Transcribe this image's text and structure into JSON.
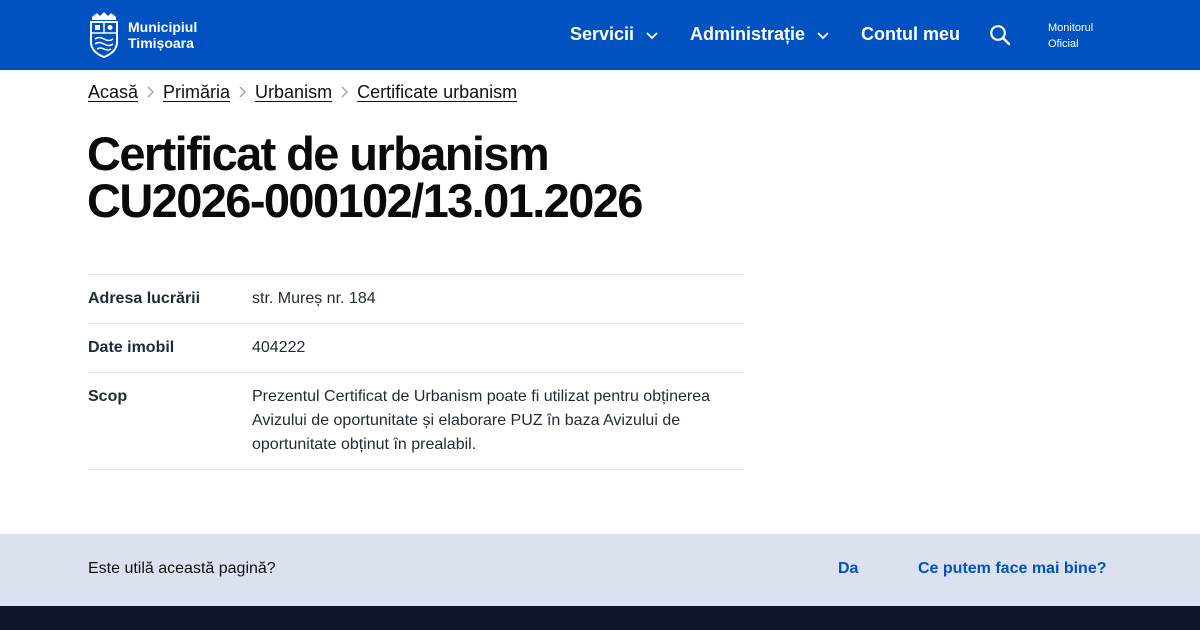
{
  "colors": {
    "brand": "#0052c1",
    "feedback_bg": "#dbe1ee",
    "footer_bg": "#0f1628"
  },
  "header": {
    "logo": {
      "icon": "city-crest-icon",
      "line1": "Municipiul",
      "line2": "Timișoara"
    },
    "nav": [
      {
        "label": "Servicii",
        "icon": "chevron-down-icon"
      },
      {
        "label": "Administrație",
        "icon": "chevron-down-icon"
      },
      {
        "label": "Contul meu"
      }
    ],
    "search_icon": "search-icon",
    "monitor": {
      "line1": "Monitorul",
      "line2": "Oficial"
    }
  },
  "breadcrumb": [
    {
      "label": "Acasă"
    },
    {
      "label": "Primăria"
    },
    {
      "label": "Urbanism"
    },
    {
      "label": "Certificate urbanism"
    }
  ],
  "page": {
    "title_line1": "Certificat de urbanism",
    "title_line2": "CU2026-000102/13.01.2026"
  },
  "details": [
    {
      "label": "Adresa lucrării",
      "value": "str. Mureș nr. 184"
    },
    {
      "label": "Date imobil",
      "value": "404222"
    },
    {
      "label": "Scop",
      "value": "Prezentul Certificat de Urbanism poate fi utilizat pentru obținerea Avizului de oportunitate și elaborare PUZ în baza Avizului de oportunitate obținut în prealabil."
    }
  ],
  "feedback": {
    "question": "Este utilă această pagină?",
    "yes_label": "Da",
    "improve_label": "Ce putem face mai bine?"
  }
}
